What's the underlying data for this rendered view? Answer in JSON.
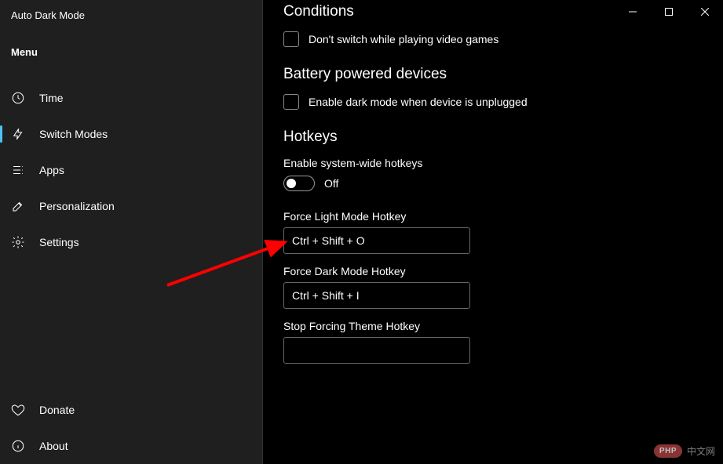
{
  "app": {
    "title": "Auto Dark Mode"
  },
  "sidebar": {
    "menu_label": "Menu",
    "items": [
      {
        "label": "Time",
        "icon": "clock-icon"
      },
      {
        "label": "Switch Modes",
        "icon": "switch-icon"
      },
      {
        "label": "Apps",
        "icon": "apps-icon"
      },
      {
        "label": "Personalization",
        "icon": "edit-icon"
      },
      {
        "label": "Settings",
        "icon": "gear-icon"
      }
    ],
    "footer_items": [
      {
        "label": "Donate",
        "icon": "heart-icon"
      },
      {
        "label": "About",
        "icon": "info-icon"
      }
    ]
  },
  "sections": {
    "conditions": {
      "title": "Conditions",
      "checkbox_label": "Don't switch while playing video games"
    },
    "battery": {
      "title": "Battery powered devices",
      "checkbox_label": "Enable dark mode when device is unplugged"
    },
    "hotkeys": {
      "title": "Hotkeys",
      "enable_label": "Enable system-wide hotkeys",
      "toggle_state": "Off",
      "fields": [
        {
          "label": "Force Light Mode Hotkey",
          "value": "Ctrl + Shift + O"
        },
        {
          "label": "Force Dark Mode Hotkey",
          "value": "Ctrl + Shift + I"
        },
        {
          "label": "Stop Forcing Theme Hotkey",
          "value": ""
        }
      ]
    }
  },
  "watermark": {
    "badge": "PHP",
    "text": "中文网"
  }
}
